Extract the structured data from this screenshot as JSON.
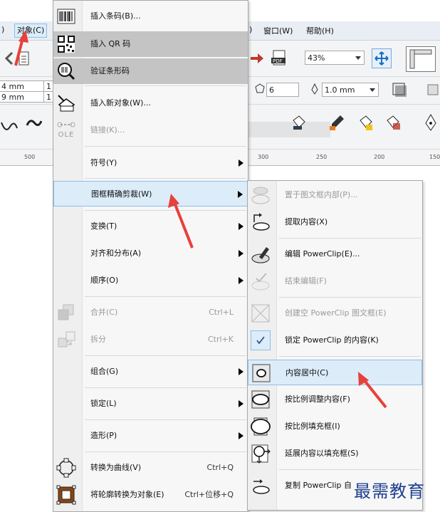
{
  "menubar": {
    "left_fragment": ")",
    "object_menu": "对象(C)",
    "right_fragment": ")",
    "window_menu": "窗口(W)",
    "help_menu": "帮助(H)"
  },
  "toolbar": {
    "zoom_value": "43%",
    "width_value": "4 mm",
    "height_value": "9 mm",
    "scale_fragment_1": "1",
    "scale_fragment_2": "1",
    "sides_value": "6",
    "outline_width": "1.0 mm"
  },
  "ruler": {
    "labels": [
      "500",
      "300",
      "250",
      "200",
      "150"
    ]
  },
  "object_menu_items": [
    {
      "label": "插入条码(B)...",
      "icon": "barcode-icon"
    },
    {
      "label": "插入 QR 码",
      "icon": "qr-code-icon"
    },
    {
      "label": "验证条形码",
      "icon": "verify-barcode-icon"
    },
    {
      "label": "插入新对象(W)...",
      "icon": "insert-object-icon"
    },
    {
      "label": "链接(K)...",
      "icon": "ole-icon",
      "icon_text": "OLE"
    },
    {
      "label": "符号(Y)"
    },
    {
      "label": "图框精确剪裁(W)"
    },
    {
      "label": "变换(T)"
    },
    {
      "label": "对齐和分布(A)"
    },
    {
      "label": "顺序(O)"
    },
    {
      "label": "合并(C)",
      "shortcut": "Ctrl+L",
      "icon": "combine-icon"
    },
    {
      "label": "拆分",
      "shortcut": "Ctrl+K",
      "icon": "break-apart-icon"
    },
    {
      "label": "组合(G)"
    },
    {
      "label": "锁定(L)"
    },
    {
      "label": "造形(P)"
    },
    {
      "label": "转换为曲线(V)",
      "shortcut": "Ctrl+Q",
      "icon": "convert-curves-icon"
    },
    {
      "label": "将轮廓转换为对象(E)",
      "shortcut": "Ctrl+位移+Q",
      "icon": "outline-to-object-icon"
    }
  ],
  "powerclip_menu_items": [
    {
      "label": "置于图文框内部(P)...",
      "icon": "place-inside-icon"
    },
    {
      "label": "提取内容(X)",
      "icon": "extract-contents-icon"
    },
    {
      "label": "编辑 PowerClip(E)...",
      "icon": "edit-powerclip-icon"
    },
    {
      "label": "结束编辑(F)",
      "icon": "finish-editing-icon"
    },
    {
      "label": "创建空 PowerClip 图文框(E)",
      "icon": "empty-frame-icon"
    },
    {
      "label": "锁定 PowerClip 的内容(K)",
      "icon": "check-icon"
    },
    {
      "label": "内容居中(C)",
      "icon": "center-content-icon"
    },
    {
      "label": "按比例调整内容(F)",
      "icon": "fit-proportional-icon"
    },
    {
      "label": "按比例填充框(I)",
      "icon": "fill-frame-icon"
    },
    {
      "label": "延展内容以填充框(S)",
      "icon": "stretch-content-icon"
    },
    {
      "label": "复制 PowerClip 自",
      "icon": "copy-powerclip-icon"
    }
  ],
  "watermark": "最需教育",
  "colors": {
    "highlight": "#dcecf9",
    "highlight_border": "#8fbde8",
    "arrow": "#e8403a"
  }
}
